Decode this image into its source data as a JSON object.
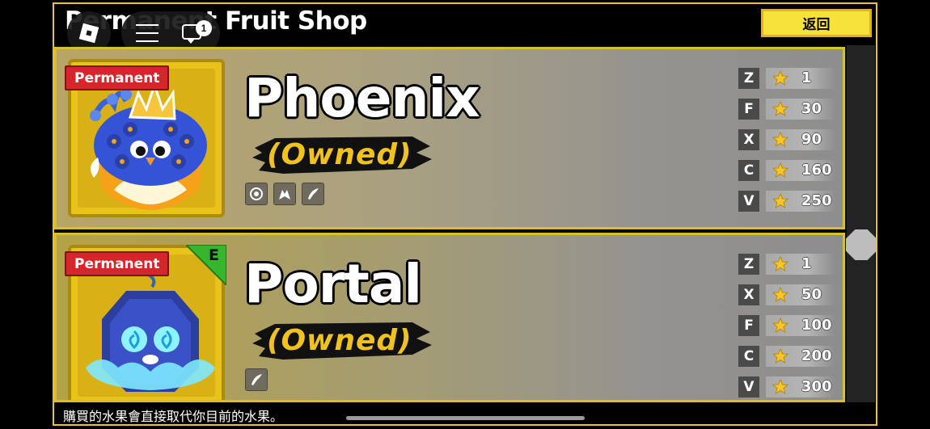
{
  "header": {
    "title": "Permanent Fruit Shop",
    "back_label": "返回"
  },
  "roblox": {
    "chat_badge": "1"
  },
  "fruits": [
    {
      "badge": "Permanent",
      "name": "Phoenix",
      "status": "(Owned)",
      "abilities": [
        "aura-icon",
        "dragon-icon",
        "sword-icon"
      ],
      "moves": [
        {
          "key": "Z",
          "cost": "1"
        },
        {
          "key": "F",
          "cost": "30"
        },
        {
          "key": "X",
          "cost": "90"
        },
        {
          "key": "C",
          "cost": "160"
        },
        {
          "key": "V",
          "cost": "250"
        }
      ]
    },
    {
      "badge": "Permanent",
      "tier": "E",
      "name": "Portal",
      "status": "(Owned)",
      "abilities": [
        "sword-icon"
      ],
      "moves": [
        {
          "key": "Z",
          "cost": "1"
        },
        {
          "key": "X",
          "cost": "50"
        },
        {
          "key": "F",
          "cost": "100"
        },
        {
          "key": "C",
          "cost": "200"
        },
        {
          "key": "V",
          "cost": "300"
        }
      ]
    }
  ],
  "footer": {
    "note": "購買的水果會直接取代你目前的水果。"
  },
  "colors": {
    "accent": "#e9c628",
    "badge_red": "#d7262b",
    "owned_yellow": "#f1c21b"
  }
}
